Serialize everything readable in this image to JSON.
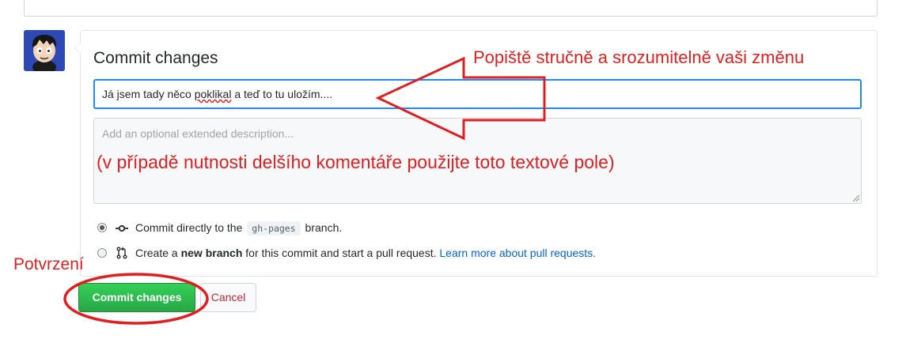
{
  "commit_form": {
    "heading": "Commit changes",
    "summary_value_before": "Já jsem tady něco ",
    "summary_value_misspelled": "poklikal",
    "summary_value_after": " a teď to tu uložím....",
    "description_placeholder": "Add an optional extended description...",
    "option_direct": {
      "text_before": "Commit directly to the",
      "branch": "gh-pages",
      "text_after": "branch.",
      "selected": true
    },
    "option_new_branch": {
      "text_before": "Create a",
      "bold": "new branch",
      "text_after": "for this commit and start a pull request.",
      "link": "Learn more about pull requests.",
      "selected": false
    },
    "commit_button_label": "Commit changes",
    "cancel_button_label": "Cancel"
  },
  "annotations": {
    "summary_hint": "Popiště stručně a srozumitelně vaši změnu",
    "description_hint": "(v případě nutnosti delšího komentáře použijte toto textové pole)",
    "confirm_hint": "Potvrzení",
    "color": "#e02020"
  },
  "colors": {
    "commit_button": "#28a745",
    "link": "#0366d6",
    "cancel_text": "#cb2431",
    "focus_border": "#2188ff"
  },
  "icons": {
    "direct_commit": "git-commit-icon",
    "new_branch": "git-pull-request-icon"
  }
}
